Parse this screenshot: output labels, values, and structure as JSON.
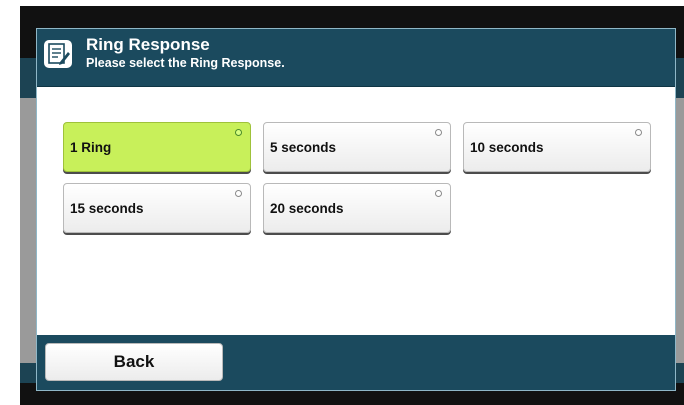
{
  "dialog": {
    "title": "Ring Response",
    "subtitle": "Please select the Ring Response."
  },
  "options": [
    {
      "label": "1 Ring",
      "selected": true
    },
    {
      "label": "5 seconds",
      "selected": false
    },
    {
      "label": "10 seconds",
      "selected": false
    },
    {
      "label": "15 seconds",
      "selected": false
    },
    {
      "label": "20 seconds",
      "selected": false
    }
  ],
  "footer": {
    "back_label": "Back"
  },
  "colors": {
    "header": "#1b4a5e",
    "selected": "#c8f05a"
  },
  "icons": {
    "header": "document-edit-icon"
  }
}
